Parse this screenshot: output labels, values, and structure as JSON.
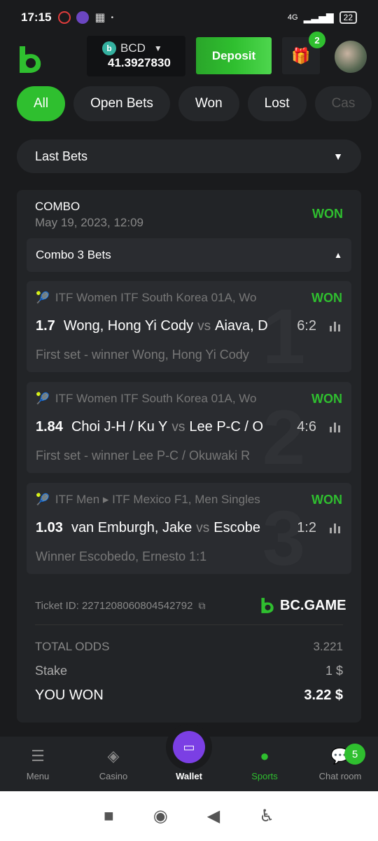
{
  "status": {
    "time": "17:15",
    "network": "4G",
    "battery": "22"
  },
  "header": {
    "currency": "BCD",
    "balance": "41.3927830",
    "deposit_label": "Deposit",
    "gift_badge": "2"
  },
  "tabs": [
    {
      "label": "All",
      "active": true
    },
    {
      "label": "Open Bets",
      "active": false
    },
    {
      "label": "Won",
      "active": false
    },
    {
      "label": "Lost",
      "active": false
    },
    {
      "label": "Cas",
      "active": false
    }
  ],
  "dropdown": {
    "label": "Last Bets"
  },
  "combo": {
    "title": "COMBO",
    "date": "May 19, 2023, 12:09",
    "status": "WON",
    "bets_label": "Combo 3 Bets",
    "bets": [
      {
        "num": "1",
        "league": "ITF Women ITF South Korea 01A, Wo",
        "status": "WON",
        "odds": "1.7",
        "home": "Wong, Hong Yi Cody",
        "vs": "vs",
        "away": "Aiava, D",
        "score": "6:2",
        "pick": "First set - winner Wong, Hong Yi Cody"
      },
      {
        "num": "2",
        "league": "ITF Women ITF South Korea 01A, Wo",
        "status": "WON",
        "odds": "1.84",
        "home": "Choi J-H / Ku Y",
        "vs": "vs",
        "away": "Lee P-C / O",
        "score": "4:6",
        "pick": "First set - winner Lee P-C / Okuwaki R"
      },
      {
        "num": "3",
        "league": "ITF Men ▸ ITF Mexico F1, Men Singles",
        "status": "WON",
        "odds": "1.03",
        "home": "van Emburgh, Jake",
        "vs": "vs",
        "away": "Escobe",
        "score": "1:2",
        "pick": "Winner Escobedo, Ernesto  1:1"
      }
    ],
    "ticket_label": "Ticket ID: 2271208060804542792",
    "brand": "BC.GAME",
    "total_odds_label": "TOTAL ODDS",
    "total_odds": "3.221",
    "stake_label": "Stake",
    "stake": "1 $",
    "won_label": "YOU WON",
    "won": "3.22 $"
  },
  "nav": {
    "menu": "Menu",
    "casino": "Casino",
    "wallet": "Wallet",
    "sports": "Sports",
    "chat": "Chat room",
    "chat_badge": "5"
  },
  "colors": {
    "accent": "#2fbf2f",
    "wallet": "#7b3fe4",
    "bg": "#1a1b1d"
  }
}
